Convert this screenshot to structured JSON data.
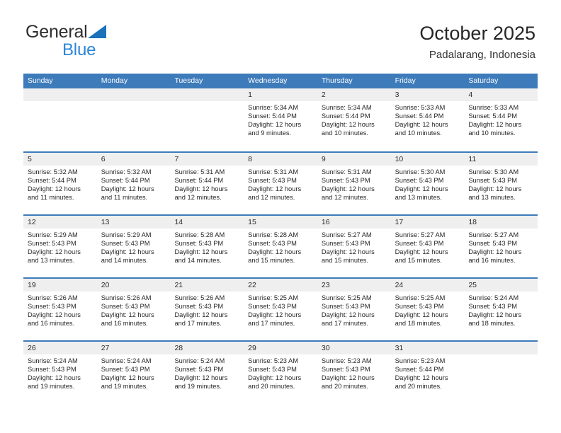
{
  "brand": {
    "name_part1": "General",
    "name_part2": "Blue",
    "triangle_color": "#1b72bb",
    "blue_text_color": "#2e86d8"
  },
  "header": {
    "title": "October 2025",
    "location": "Padalarang, Indonesia"
  },
  "theme": {
    "header_row_bg": "#3d7bba",
    "date_strip_bg": "#efefef",
    "separator_color": "#3d7bba",
    "text_color": "#262626"
  },
  "weekdays": [
    "Sunday",
    "Monday",
    "Tuesday",
    "Wednesday",
    "Thursday",
    "Friday",
    "Saturday"
  ],
  "weeks": [
    [
      {
        "day": "",
        "lines": []
      },
      {
        "day": "",
        "lines": []
      },
      {
        "day": "",
        "lines": []
      },
      {
        "day": "1",
        "lines": [
          "Sunrise: 5:34 AM",
          "Sunset: 5:44 PM",
          "Daylight: 12 hours",
          "and 9 minutes."
        ]
      },
      {
        "day": "2",
        "lines": [
          "Sunrise: 5:34 AM",
          "Sunset: 5:44 PM",
          "Daylight: 12 hours",
          "and 10 minutes."
        ]
      },
      {
        "day": "3",
        "lines": [
          "Sunrise: 5:33 AM",
          "Sunset: 5:44 PM",
          "Daylight: 12 hours",
          "and 10 minutes."
        ]
      },
      {
        "day": "4",
        "lines": [
          "Sunrise: 5:33 AM",
          "Sunset: 5:44 PM",
          "Daylight: 12 hours",
          "and 10 minutes."
        ]
      }
    ],
    [
      {
        "day": "5",
        "lines": [
          "Sunrise: 5:32 AM",
          "Sunset: 5:44 PM",
          "Daylight: 12 hours",
          "and 11 minutes."
        ]
      },
      {
        "day": "6",
        "lines": [
          "Sunrise: 5:32 AM",
          "Sunset: 5:44 PM",
          "Daylight: 12 hours",
          "and 11 minutes."
        ]
      },
      {
        "day": "7",
        "lines": [
          "Sunrise: 5:31 AM",
          "Sunset: 5:44 PM",
          "Daylight: 12 hours",
          "and 12 minutes."
        ]
      },
      {
        "day": "8",
        "lines": [
          "Sunrise: 5:31 AM",
          "Sunset: 5:43 PM",
          "Daylight: 12 hours",
          "and 12 minutes."
        ]
      },
      {
        "day": "9",
        "lines": [
          "Sunrise: 5:31 AM",
          "Sunset: 5:43 PM",
          "Daylight: 12 hours",
          "and 12 minutes."
        ]
      },
      {
        "day": "10",
        "lines": [
          "Sunrise: 5:30 AM",
          "Sunset: 5:43 PM",
          "Daylight: 12 hours",
          "and 13 minutes."
        ]
      },
      {
        "day": "11",
        "lines": [
          "Sunrise: 5:30 AM",
          "Sunset: 5:43 PM",
          "Daylight: 12 hours",
          "and 13 minutes."
        ]
      }
    ],
    [
      {
        "day": "12",
        "lines": [
          "Sunrise: 5:29 AM",
          "Sunset: 5:43 PM",
          "Daylight: 12 hours",
          "and 13 minutes."
        ]
      },
      {
        "day": "13",
        "lines": [
          "Sunrise: 5:29 AM",
          "Sunset: 5:43 PM",
          "Daylight: 12 hours",
          "and 14 minutes."
        ]
      },
      {
        "day": "14",
        "lines": [
          "Sunrise: 5:28 AM",
          "Sunset: 5:43 PM",
          "Daylight: 12 hours",
          "and 14 minutes."
        ]
      },
      {
        "day": "15",
        "lines": [
          "Sunrise: 5:28 AM",
          "Sunset: 5:43 PM",
          "Daylight: 12 hours",
          "and 15 minutes."
        ]
      },
      {
        "day": "16",
        "lines": [
          "Sunrise: 5:27 AM",
          "Sunset: 5:43 PM",
          "Daylight: 12 hours",
          "and 15 minutes."
        ]
      },
      {
        "day": "17",
        "lines": [
          "Sunrise: 5:27 AM",
          "Sunset: 5:43 PM",
          "Daylight: 12 hours",
          "and 15 minutes."
        ]
      },
      {
        "day": "18",
        "lines": [
          "Sunrise: 5:27 AM",
          "Sunset: 5:43 PM",
          "Daylight: 12 hours",
          "and 16 minutes."
        ]
      }
    ],
    [
      {
        "day": "19",
        "lines": [
          "Sunrise: 5:26 AM",
          "Sunset: 5:43 PM",
          "Daylight: 12 hours",
          "and 16 minutes."
        ]
      },
      {
        "day": "20",
        "lines": [
          "Sunrise: 5:26 AM",
          "Sunset: 5:43 PM",
          "Daylight: 12 hours",
          "and 16 minutes."
        ]
      },
      {
        "day": "21",
        "lines": [
          "Sunrise: 5:26 AM",
          "Sunset: 5:43 PM",
          "Daylight: 12 hours",
          "and 17 minutes."
        ]
      },
      {
        "day": "22",
        "lines": [
          "Sunrise: 5:25 AM",
          "Sunset: 5:43 PM",
          "Daylight: 12 hours",
          "and 17 minutes."
        ]
      },
      {
        "day": "23",
        "lines": [
          "Sunrise: 5:25 AM",
          "Sunset: 5:43 PM",
          "Daylight: 12 hours",
          "and 17 minutes."
        ]
      },
      {
        "day": "24",
        "lines": [
          "Sunrise: 5:25 AM",
          "Sunset: 5:43 PM",
          "Daylight: 12 hours",
          "and 18 minutes."
        ]
      },
      {
        "day": "25",
        "lines": [
          "Sunrise: 5:24 AM",
          "Sunset: 5:43 PM",
          "Daylight: 12 hours",
          "and 18 minutes."
        ]
      }
    ],
    [
      {
        "day": "26",
        "lines": [
          "Sunrise: 5:24 AM",
          "Sunset: 5:43 PM",
          "Daylight: 12 hours",
          "and 19 minutes."
        ]
      },
      {
        "day": "27",
        "lines": [
          "Sunrise: 5:24 AM",
          "Sunset: 5:43 PM",
          "Daylight: 12 hours",
          "and 19 minutes."
        ]
      },
      {
        "day": "28",
        "lines": [
          "Sunrise: 5:24 AM",
          "Sunset: 5:43 PM",
          "Daylight: 12 hours",
          "and 19 minutes."
        ]
      },
      {
        "day": "29",
        "lines": [
          "Sunrise: 5:23 AM",
          "Sunset: 5:43 PM",
          "Daylight: 12 hours",
          "and 20 minutes."
        ]
      },
      {
        "day": "30",
        "lines": [
          "Sunrise: 5:23 AM",
          "Sunset: 5:43 PM",
          "Daylight: 12 hours",
          "and 20 minutes."
        ]
      },
      {
        "day": "31",
        "lines": [
          "Sunrise: 5:23 AM",
          "Sunset: 5:44 PM",
          "Daylight: 12 hours",
          "and 20 minutes."
        ]
      },
      {
        "day": "",
        "lines": []
      }
    ]
  ]
}
